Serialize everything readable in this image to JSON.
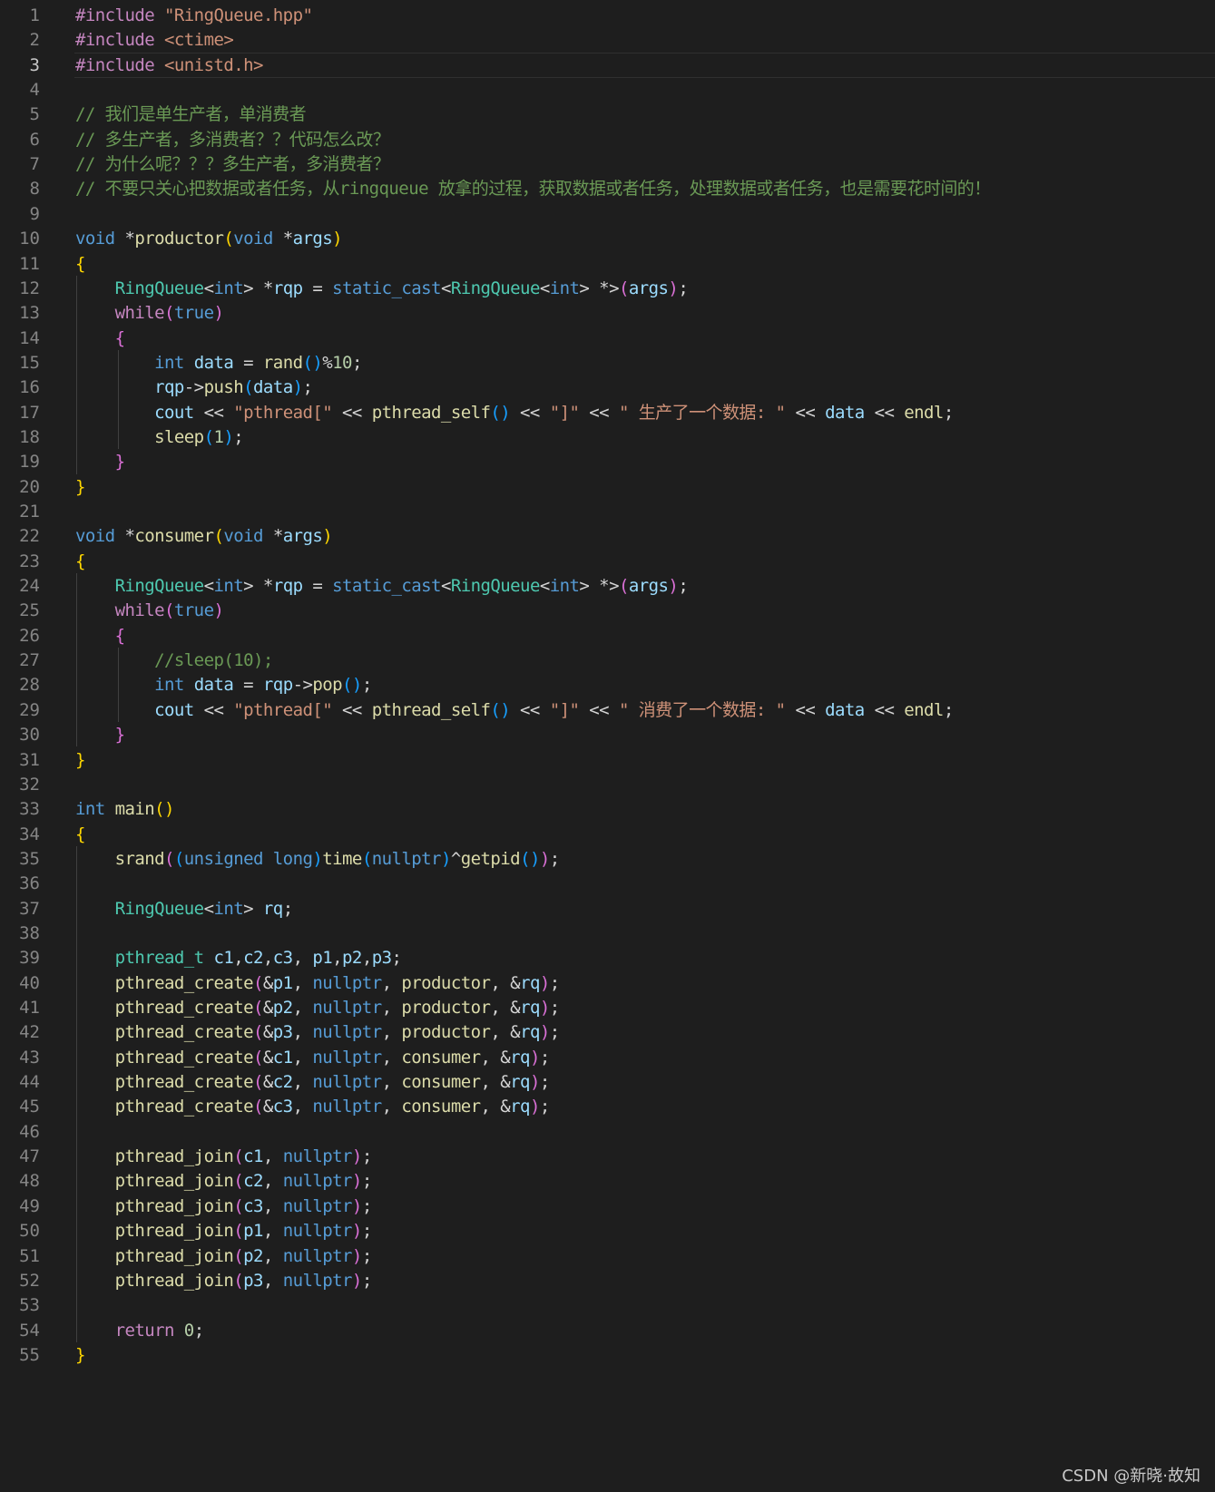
{
  "editor": {
    "current_line": 3,
    "lines": [
      [
        [
          "#include ",
          "pp"
        ],
        [
          "\"RingQueue.hpp\"",
          "str"
        ]
      ],
      [
        [
          "#include ",
          "pp"
        ],
        [
          "<ctime>",
          "str"
        ]
      ],
      [
        [
          "#include ",
          "pp"
        ],
        [
          "<unistd.h>",
          "str"
        ]
      ],
      [],
      [
        [
          "// 我们是单生产者，单消费者",
          "cmt"
        ]
      ],
      [
        [
          "// 多生产者，多消费者？？代码怎么改？",
          "cmt"
        ]
      ],
      [
        [
          "// 为什么呢？？？多生产者，多消费者？",
          "cmt"
        ]
      ],
      [
        [
          "// 不要只关心把数据或者任务，从ringqueue 放拿的过程，获取数据或者任务，处理数据或者任务，也是需要花时间的！",
          "cmt"
        ]
      ],
      [],
      [
        [
          "void ",
          "kw"
        ],
        [
          "*",
          "op"
        ],
        [
          "productor",
          "fn"
        ],
        [
          "(",
          "b1"
        ],
        [
          "void ",
          "kw"
        ],
        [
          "*",
          "op"
        ],
        [
          "args",
          "var"
        ],
        [
          ")",
          "b1"
        ]
      ],
      [
        [
          "{",
          "b1"
        ]
      ],
      [
        [
          "    ",
          "op"
        ],
        [
          "RingQueue",
          "type"
        ],
        [
          "<",
          "op"
        ],
        [
          "int",
          "kw"
        ],
        [
          "> *",
          "op"
        ],
        [
          "rqp",
          "var"
        ],
        [
          " = ",
          "op"
        ],
        [
          "static_cast",
          "kw"
        ],
        [
          "<",
          "op"
        ],
        [
          "RingQueue",
          "type"
        ],
        [
          "<",
          "op"
        ],
        [
          "int",
          "kw"
        ],
        [
          "> *>",
          "op"
        ],
        [
          "(",
          "b2"
        ],
        [
          "args",
          "var"
        ],
        [
          ")",
          "b2"
        ],
        [
          ";",
          "op"
        ]
      ],
      [
        [
          "    ",
          "op"
        ],
        [
          "while",
          "ctl"
        ],
        [
          "(",
          "b2"
        ],
        [
          "true",
          "kw"
        ],
        [
          ")",
          "b2"
        ]
      ],
      [
        [
          "    ",
          "op"
        ],
        [
          "{",
          "b2"
        ]
      ],
      [
        [
          "        ",
          "op"
        ],
        [
          "int ",
          "kw"
        ],
        [
          "data",
          "var"
        ],
        [
          " = ",
          "op"
        ],
        [
          "rand",
          "fn"
        ],
        [
          "()",
          "b3"
        ],
        [
          "%",
          "op"
        ],
        [
          "10",
          "num"
        ],
        [
          ";",
          "op"
        ]
      ],
      [
        [
          "        ",
          "op"
        ],
        [
          "rqp",
          "var"
        ],
        [
          "->",
          "op"
        ],
        [
          "push",
          "fn"
        ],
        [
          "(",
          "b3"
        ],
        [
          "data",
          "var"
        ],
        [
          ")",
          "b3"
        ],
        [
          ";",
          "op"
        ]
      ],
      [
        [
          "        ",
          "op"
        ],
        [
          "cout",
          "var"
        ],
        [
          " << ",
          "op"
        ],
        [
          "\"pthread[\"",
          "str"
        ],
        [
          " << ",
          "op"
        ],
        [
          "pthread_self",
          "fn"
        ],
        [
          "()",
          "b3"
        ],
        [
          " << ",
          "op"
        ],
        [
          "\"]\"",
          "str"
        ],
        [
          " << ",
          "op"
        ],
        [
          "\" 生产了一个数据: \"",
          "str"
        ],
        [
          " << ",
          "op"
        ],
        [
          "data",
          "var"
        ],
        [
          " << ",
          "op"
        ],
        [
          "endl",
          "fn"
        ],
        [
          ";",
          "op"
        ]
      ],
      [
        [
          "        ",
          "op"
        ],
        [
          "sleep",
          "fn"
        ],
        [
          "(",
          "b3"
        ],
        [
          "1",
          "num"
        ],
        [
          ")",
          "b3"
        ],
        [
          ";",
          "op"
        ]
      ],
      [
        [
          "    ",
          "op"
        ],
        [
          "}",
          "b2"
        ]
      ],
      [
        [
          "}",
          "b1"
        ]
      ],
      [],
      [
        [
          "void ",
          "kw"
        ],
        [
          "*",
          "op"
        ],
        [
          "consumer",
          "fn"
        ],
        [
          "(",
          "b1"
        ],
        [
          "void ",
          "kw"
        ],
        [
          "*",
          "op"
        ],
        [
          "args",
          "var"
        ],
        [
          ")",
          "b1"
        ]
      ],
      [
        [
          "{",
          "b1"
        ]
      ],
      [
        [
          "    ",
          "op"
        ],
        [
          "RingQueue",
          "type"
        ],
        [
          "<",
          "op"
        ],
        [
          "int",
          "kw"
        ],
        [
          "> *",
          "op"
        ],
        [
          "rqp",
          "var"
        ],
        [
          " = ",
          "op"
        ],
        [
          "static_cast",
          "kw"
        ],
        [
          "<",
          "op"
        ],
        [
          "RingQueue",
          "type"
        ],
        [
          "<",
          "op"
        ],
        [
          "int",
          "kw"
        ],
        [
          "> *>",
          "op"
        ],
        [
          "(",
          "b2"
        ],
        [
          "args",
          "var"
        ],
        [
          ")",
          "b2"
        ],
        [
          ";",
          "op"
        ]
      ],
      [
        [
          "    ",
          "op"
        ],
        [
          "while",
          "ctl"
        ],
        [
          "(",
          "b2"
        ],
        [
          "true",
          "kw"
        ],
        [
          ")",
          "b2"
        ]
      ],
      [
        [
          "    ",
          "op"
        ],
        [
          "{",
          "b2"
        ]
      ],
      [
        [
          "        ",
          "op"
        ],
        [
          "//sleep(10);",
          "cmt"
        ]
      ],
      [
        [
          "        ",
          "op"
        ],
        [
          "int ",
          "kw"
        ],
        [
          "data",
          "var"
        ],
        [
          " = ",
          "op"
        ],
        [
          "rqp",
          "var"
        ],
        [
          "->",
          "op"
        ],
        [
          "pop",
          "fn"
        ],
        [
          "()",
          "b3"
        ],
        [
          ";",
          "op"
        ]
      ],
      [
        [
          "        ",
          "op"
        ],
        [
          "cout",
          "var"
        ],
        [
          " << ",
          "op"
        ],
        [
          "\"pthread[\"",
          "str"
        ],
        [
          " << ",
          "op"
        ],
        [
          "pthread_self",
          "fn"
        ],
        [
          "()",
          "b3"
        ],
        [
          " << ",
          "op"
        ],
        [
          "\"]\"",
          "str"
        ],
        [
          " << ",
          "op"
        ],
        [
          "\" 消费了一个数据: \"",
          "str"
        ],
        [
          " << ",
          "op"
        ],
        [
          "data",
          "var"
        ],
        [
          " << ",
          "op"
        ],
        [
          "endl",
          "fn"
        ],
        [
          ";",
          "op"
        ]
      ],
      [
        [
          "    ",
          "op"
        ],
        [
          "}",
          "b2"
        ]
      ],
      [
        [
          "}",
          "b1"
        ]
      ],
      [],
      [
        [
          "int ",
          "kw"
        ],
        [
          "main",
          "fn"
        ],
        [
          "()",
          "b1"
        ]
      ],
      [
        [
          "{",
          "b1"
        ]
      ],
      [
        [
          "    ",
          "op"
        ],
        [
          "srand",
          "fn"
        ],
        [
          "(",
          "b2"
        ],
        [
          "(",
          "b3"
        ],
        [
          "unsigned long",
          "kw"
        ],
        [
          ")",
          "b3"
        ],
        [
          "time",
          "fn"
        ],
        [
          "(",
          "b3"
        ],
        [
          "nullptr",
          "kw"
        ],
        [
          ")",
          "b3"
        ],
        [
          "^",
          "op"
        ],
        [
          "getpid",
          "fn"
        ],
        [
          "()",
          "b3"
        ],
        [
          ")",
          "b2"
        ],
        [
          ";",
          "op"
        ]
      ],
      [],
      [
        [
          "    ",
          "op"
        ],
        [
          "RingQueue",
          "type"
        ],
        [
          "<",
          "op"
        ],
        [
          "int",
          "kw"
        ],
        [
          "> ",
          "op"
        ],
        [
          "rq",
          "var"
        ],
        [
          ";",
          "op"
        ]
      ],
      [],
      [
        [
          "    ",
          "op"
        ],
        [
          "pthread_t ",
          "type"
        ],
        [
          "c1",
          "var"
        ],
        [
          ",",
          "op"
        ],
        [
          "c2",
          "var"
        ],
        [
          ",",
          "op"
        ],
        [
          "c3",
          "var"
        ],
        [
          ", ",
          "op"
        ],
        [
          "p1",
          "var"
        ],
        [
          ",",
          "op"
        ],
        [
          "p2",
          "var"
        ],
        [
          ",",
          "op"
        ],
        [
          "p3",
          "var"
        ],
        [
          ";",
          "op"
        ]
      ],
      [
        [
          "    ",
          "op"
        ],
        [
          "pthread_create",
          "fn"
        ],
        [
          "(",
          "b2"
        ],
        [
          "&",
          "op"
        ],
        [
          "p1",
          "var"
        ],
        [
          ", ",
          "op"
        ],
        [
          "nullptr",
          "kw"
        ],
        [
          ", ",
          "op"
        ],
        [
          "productor",
          "fn"
        ],
        [
          ", &",
          "op"
        ],
        [
          "rq",
          "var"
        ],
        [
          ")",
          "b2"
        ],
        [
          ";",
          "op"
        ]
      ],
      [
        [
          "    ",
          "op"
        ],
        [
          "pthread_create",
          "fn"
        ],
        [
          "(",
          "b2"
        ],
        [
          "&",
          "op"
        ],
        [
          "p2",
          "var"
        ],
        [
          ", ",
          "op"
        ],
        [
          "nullptr",
          "kw"
        ],
        [
          ", ",
          "op"
        ],
        [
          "productor",
          "fn"
        ],
        [
          ", &",
          "op"
        ],
        [
          "rq",
          "var"
        ],
        [
          ")",
          "b2"
        ],
        [
          ";",
          "op"
        ]
      ],
      [
        [
          "    ",
          "op"
        ],
        [
          "pthread_create",
          "fn"
        ],
        [
          "(",
          "b2"
        ],
        [
          "&",
          "op"
        ],
        [
          "p3",
          "var"
        ],
        [
          ", ",
          "op"
        ],
        [
          "nullptr",
          "kw"
        ],
        [
          ", ",
          "op"
        ],
        [
          "productor",
          "fn"
        ],
        [
          ", &",
          "op"
        ],
        [
          "rq",
          "var"
        ],
        [
          ")",
          "b2"
        ],
        [
          ";",
          "op"
        ]
      ],
      [
        [
          "    ",
          "op"
        ],
        [
          "pthread_create",
          "fn"
        ],
        [
          "(",
          "b2"
        ],
        [
          "&",
          "op"
        ],
        [
          "c1",
          "var"
        ],
        [
          ", ",
          "op"
        ],
        [
          "nullptr",
          "kw"
        ],
        [
          ", ",
          "op"
        ],
        [
          "consumer",
          "fn"
        ],
        [
          ", &",
          "op"
        ],
        [
          "rq",
          "var"
        ],
        [
          ")",
          "b2"
        ],
        [
          ";",
          "op"
        ]
      ],
      [
        [
          "    ",
          "op"
        ],
        [
          "pthread_create",
          "fn"
        ],
        [
          "(",
          "b2"
        ],
        [
          "&",
          "op"
        ],
        [
          "c2",
          "var"
        ],
        [
          ", ",
          "op"
        ],
        [
          "nullptr",
          "kw"
        ],
        [
          ", ",
          "op"
        ],
        [
          "consumer",
          "fn"
        ],
        [
          ", &",
          "op"
        ],
        [
          "rq",
          "var"
        ],
        [
          ")",
          "b2"
        ],
        [
          ";",
          "op"
        ]
      ],
      [
        [
          "    ",
          "op"
        ],
        [
          "pthread_create",
          "fn"
        ],
        [
          "(",
          "b2"
        ],
        [
          "&",
          "op"
        ],
        [
          "c3",
          "var"
        ],
        [
          ", ",
          "op"
        ],
        [
          "nullptr",
          "kw"
        ],
        [
          ", ",
          "op"
        ],
        [
          "consumer",
          "fn"
        ],
        [
          ", &",
          "op"
        ],
        [
          "rq",
          "var"
        ],
        [
          ")",
          "b2"
        ],
        [
          ";",
          "op"
        ]
      ],
      [],
      [
        [
          "    ",
          "op"
        ],
        [
          "pthread_join",
          "fn"
        ],
        [
          "(",
          "b2"
        ],
        [
          "c1",
          "var"
        ],
        [
          ", ",
          "op"
        ],
        [
          "nullptr",
          "kw"
        ],
        [
          ")",
          "b2"
        ],
        [
          ";",
          "op"
        ]
      ],
      [
        [
          "    ",
          "op"
        ],
        [
          "pthread_join",
          "fn"
        ],
        [
          "(",
          "b2"
        ],
        [
          "c2",
          "var"
        ],
        [
          ", ",
          "op"
        ],
        [
          "nullptr",
          "kw"
        ],
        [
          ")",
          "b2"
        ],
        [
          ";",
          "op"
        ]
      ],
      [
        [
          "    ",
          "op"
        ],
        [
          "pthread_join",
          "fn"
        ],
        [
          "(",
          "b2"
        ],
        [
          "c3",
          "var"
        ],
        [
          ", ",
          "op"
        ],
        [
          "nullptr",
          "kw"
        ],
        [
          ")",
          "b2"
        ],
        [
          ";",
          "op"
        ]
      ],
      [
        [
          "    ",
          "op"
        ],
        [
          "pthread_join",
          "fn"
        ],
        [
          "(",
          "b2"
        ],
        [
          "p1",
          "var"
        ],
        [
          ", ",
          "op"
        ],
        [
          "nullptr",
          "kw"
        ],
        [
          ")",
          "b2"
        ],
        [
          ";",
          "op"
        ]
      ],
      [
        [
          "    ",
          "op"
        ],
        [
          "pthread_join",
          "fn"
        ],
        [
          "(",
          "b2"
        ],
        [
          "p2",
          "var"
        ],
        [
          ", ",
          "op"
        ],
        [
          "nullptr",
          "kw"
        ],
        [
          ")",
          "b2"
        ],
        [
          ";",
          "op"
        ]
      ],
      [
        [
          "    ",
          "op"
        ],
        [
          "pthread_join",
          "fn"
        ],
        [
          "(",
          "b2"
        ],
        [
          "p3",
          "var"
        ],
        [
          ", ",
          "op"
        ],
        [
          "nullptr",
          "kw"
        ],
        [
          ")",
          "b2"
        ],
        [
          ";",
          "op"
        ]
      ],
      [],
      [
        [
          "    ",
          "op"
        ],
        [
          "return ",
          "ctl"
        ],
        [
          "0",
          "num"
        ],
        [
          ";",
          "op"
        ]
      ],
      [
        [
          "}",
          "b1"
        ]
      ]
    ]
  },
  "colors": {
    "background": "#1e1e1e",
    "line_number": "#858585",
    "line_number_active": "#c6c6c6",
    "preprocessor": "#c586c0",
    "string": "#ce9178",
    "comment": "#6a9955",
    "keyword": "#569cd6",
    "type": "#4ec9b0",
    "function": "#dcdcaa",
    "variable": "#9cdcfe",
    "number": "#b5cea8",
    "bracket_level1": "#ffd700",
    "bracket_level2": "#da70d6",
    "bracket_level3": "#179fff"
  },
  "watermark": "CSDN @新晓·故知"
}
